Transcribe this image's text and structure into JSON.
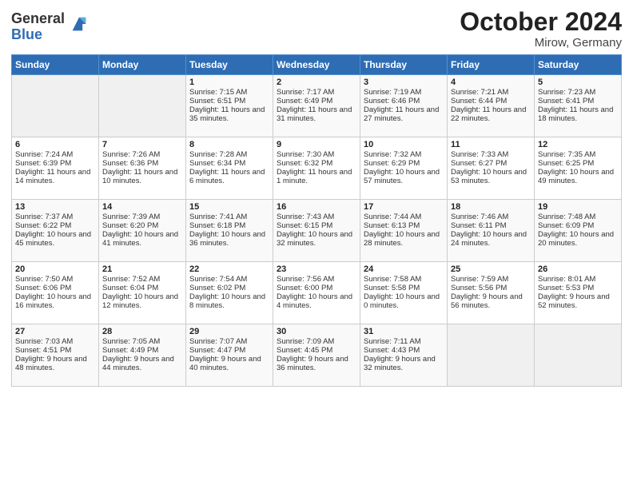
{
  "header": {
    "logo_general": "General",
    "logo_blue": "Blue",
    "title": "October 2024",
    "location": "Mirow, Germany"
  },
  "days_of_week": [
    "Sunday",
    "Monday",
    "Tuesday",
    "Wednesday",
    "Thursday",
    "Friday",
    "Saturday"
  ],
  "weeks": [
    [
      {
        "day": "",
        "content": ""
      },
      {
        "day": "",
        "content": ""
      },
      {
        "day": "1",
        "sunrise": "Sunrise: 7:15 AM",
        "sunset": "Sunset: 6:51 PM",
        "daylight": "Daylight: 11 hours and 35 minutes."
      },
      {
        "day": "2",
        "sunrise": "Sunrise: 7:17 AM",
        "sunset": "Sunset: 6:49 PM",
        "daylight": "Daylight: 11 hours and 31 minutes."
      },
      {
        "day": "3",
        "sunrise": "Sunrise: 7:19 AM",
        "sunset": "Sunset: 6:46 PM",
        "daylight": "Daylight: 11 hours and 27 minutes."
      },
      {
        "day": "4",
        "sunrise": "Sunrise: 7:21 AM",
        "sunset": "Sunset: 6:44 PM",
        "daylight": "Daylight: 11 hours and 22 minutes."
      },
      {
        "day": "5",
        "sunrise": "Sunrise: 7:23 AM",
        "sunset": "Sunset: 6:41 PM",
        "daylight": "Daylight: 11 hours and 18 minutes."
      }
    ],
    [
      {
        "day": "6",
        "sunrise": "Sunrise: 7:24 AM",
        "sunset": "Sunset: 6:39 PM",
        "daylight": "Daylight: 11 hours and 14 minutes."
      },
      {
        "day": "7",
        "sunrise": "Sunrise: 7:26 AM",
        "sunset": "Sunset: 6:36 PM",
        "daylight": "Daylight: 11 hours and 10 minutes."
      },
      {
        "day": "8",
        "sunrise": "Sunrise: 7:28 AM",
        "sunset": "Sunset: 6:34 PM",
        "daylight": "Daylight: 11 hours and 6 minutes."
      },
      {
        "day": "9",
        "sunrise": "Sunrise: 7:30 AM",
        "sunset": "Sunset: 6:32 PM",
        "daylight": "Daylight: 11 hours and 1 minute."
      },
      {
        "day": "10",
        "sunrise": "Sunrise: 7:32 AM",
        "sunset": "Sunset: 6:29 PM",
        "daylight": "Daylight: 10 hours and 57 minutes."
      },
      {
        "day": "11",
        "sunrise": "Sunrise: 7:33 AM",
        "sunset": "Sunset: 6:27 PM",
        "daylight": "Daylight: 10 hours and 53 minutes."
      },
      {
        "day": "12",
        "sunrise": "Sunrise: 7:35 AM",
        "sunset": "Sunset: 6:25 PM",
        "daylight": "Daylight: 10 hours and 49 minutes."
      }
    ],
    [
      {
        "day": "13",
        "sunrise": "Sunrise: 7:37 AM",
        "sunset": "Sunset: 6:22 PM",
        "daylight": "Daylight: 10 hours and 45 minutes."
      },
      {
        "day": "14",
        "sunrise": "Sunrise: 7:39 AM",
        "sunset": "Sunset: 6:20 PM",
        "daylight": "Daylight: 10 hours and 41 minutes."
      },
      {
        "day": "15",
        "sunrise": "Sunrise: 7:41 AM",
        "sunset": "Sunset: 6:18 PM",
        "daylight": "Daylight: 10 hours and 36 minutes."
      },
      {
        "day": "16",
        "sunrise": "Sunrise: 7:43 AM",
        "sunset": "Sunset: 6:15 PM",
        "daylight": "Daylight: 10 hours and 32 minutes."
      },
      {
        "day": "17",
        "sunrise": "Sunrise: 7:44 AM",
        "sunset": "Sunset: 6:13 PM",
        "daylight": "Daylight: 10 hours and 28 minutes."
      },
      {
        "day": "18",
        "sunrise": "Sunrise: 7:46 AM",
        "sunset": "Sunset: 6:11 PM",
        "daylight": "Daylight: 10 hours and 24 minutes."
      },
      {
        "day": "19",
        "sunrise": "Sunrise: 7:48 AM",
        "sunset": "Sunset: 6:09 PM",
        "daylight": "Daylight: 10 hours and 20 minutes."
      }
    ],
    [
      {
        "day": "20",
        "sunrise": "Sunrise: 7:50 AM",
        "sunset": "Sunset: 6:06 PM",
        "daylight": "Daylight: 10 hours and 16 minutes."
      },
      {
        "day": "21",
        "sunrise": "Sunrise: 7:52 AM",
        "sunset": "Sunset: 6:04 PM",
        "daylight": "Daylight: 10 hours and 12 minutes."
      },
      {
        "day": "22",
        "sunrise": "Sunrise: 7:54 AM",
        "sunset": "Sunset: 6:02 PM",
        "daylight": "Daylight: 10 hours and 8 minutes."
      },
      {
        "day": "23",
        "sunrise": "Sunrise: 7:56 AM",
        "sunset": "Sunset: 6:00 PM",
        "daylight": "Daylight: 10 hours and 4 minutes."
      },
      {
        "day": "24",
        "sunrise": "Sunrise: 7:58 AM",
        "sunset": "Sunset: 5:58 PM",
        "daylight": "Daylight: 10 hours and 0 minutes."
      },
      {
        "day": "25",
        "sunrise": "Sunrise: 7:59 AM",
        "sunset": "Sunset: 5:56 PM",
        "daylight": "Daylight: 9 hours and 56 minutes."
      },
      {
        "day": "26",
        "sunrise": "Sunrise: 8:01 AM",
        "sunset": "Sunset: 5:53 PM",
        "daylight": "Daylight: 9 hours and 52 minutes."
      }
    ],
    [
      {
        "day": "27",
        "sunrise": "Sunrise: 7:03 AM",
        "sunset": "Sunset: 4:51 PM",
        "daylight": "Daylight: 9 hours and 48 minutes."
      },
      {
        "day": "28",
        "sunrise": "Sunrise: 7:05 AM",
        "sunset": "Sunset: 4:49 PM",
        "daylight": "Daylight: 9 hours and 44 minutes."
      },
      {
        "day": "29",
        "sunrise": "Sunrise: 7:07 AM",
        "sunset": "Sunset: 4:47 PM",
        "daylight": "Daylight: 9 hours and 40 minutes."
      },
      {
        "day": "30",
        "sunrise": "Sunrise: 7:09 AM",
        "sunset": "Sunset: 4:45 PM",
        "daylight": "Daylight: 9 hours and 36 minutes."
      },
      {
        "day": "31",
        "sunrise": "Sunrise: 7:11 AM",
        "sunset": "Sunset: 4:43 PM",
        "daylight": "Daylight: 9 hours and 32 minutes."
      },
      {
        "day": "",
        "content": ""
      },
      {
        "day": "",
        "content": ""
      }
    ]
  ]
}
